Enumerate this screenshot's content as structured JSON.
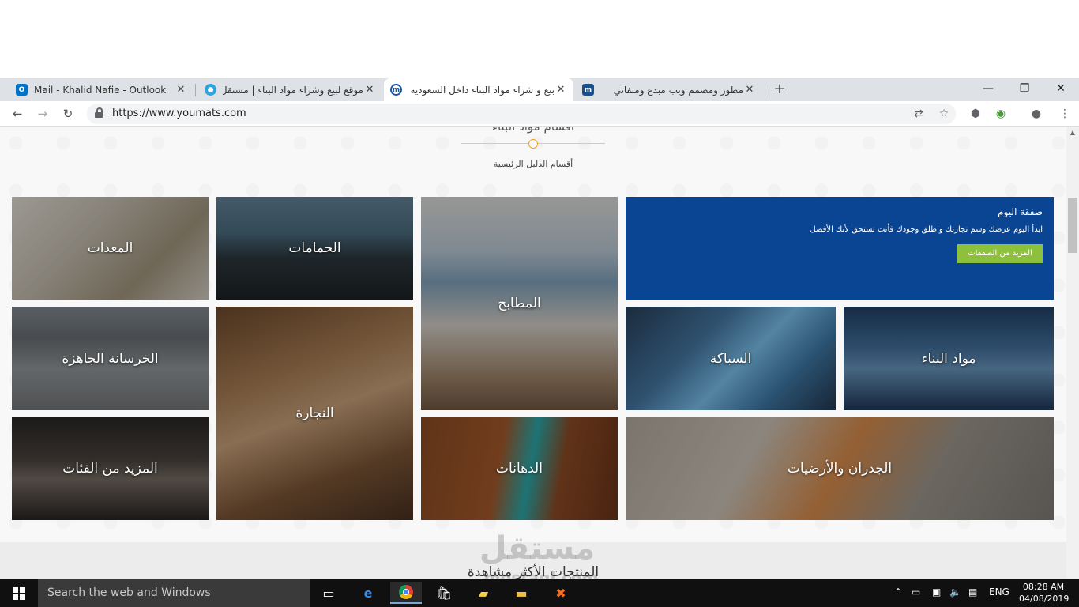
{
  "browser": {
    "tabs": [
      {
        "title": "Mail - Khalid Nafie - Outlook",
        "favicon": "outlook-icon",
        "color": "#0072c6",
        "active": false
      },
      {
        "title": "موقع لبيع وشراء مواد البناء | مستقل",
        "favicon": "mostaql-icon",
        "color": "#2ba5e0",
        "active": false
      },
      {
        "title": "بيع و شراء مواد البناء داخل السعودية",
        "favicon": "yourmats-icon",
        "color": "#1a56a8",
        "active": true
      },
      {
        "title": "مطور ومصمم ويب مبدع ومتفاني",
        "favicon": "mostaql-m-icon",
        "color": "#1b4f8a",
        "active": false
      }
    ],
    "new_tab": "+",
    "window_controls": {
      "minimize": "—",
      "maximize": "❐",
      "close": "✕"
    },
    "url": "https://www.youmats.com"
  },
  "section": {
    "title": "أقسام مواد البناء",
    "subtitle": "أقسام الدليل الرئيسية"
  },
  "promo": {
    "heading": "صفقة اليوم",
    "text": "ابدأ اليوم عرضك وسم تجارتك واطلق وجودك فأنت تستحق لأنك الأفضل",
    "button": "المزيد من الصفقات",
    "bg_color": "#0a4594",
    "button_color": "#8dc03c"
  },
  "categories": [
    {
      "label": "المعدات"
    },
    {
      "label": "الحمامات"
    },
    {
      "label": "المطابخ"
    },
    {
      "label": "الخرسانة الجاهزة"
    },
    {
      "label": "النجارة"
    },
    {
      "label": "السباكة"
    },
    {
      "label": "مواد البناء"
    },
    {
      "label": "المزيد من الفئات"
    },
    {
      "label": "الدهانات"
    },
    {
      "label": "الجدران والأرضيات"
    }
  ],
  "bottom": {
    "title": "المنتجات الأكثر مشاهدة",
    "watermark": "مستقل",
    "watermark_sub": "mostaql.com"
  },
  "taskbar": {
    "search_placeholder": "Search the web and Windows",
    "language": "ENG",
    "time": "08:28 AM",
    "date": "04/08/2019"
  }
}
